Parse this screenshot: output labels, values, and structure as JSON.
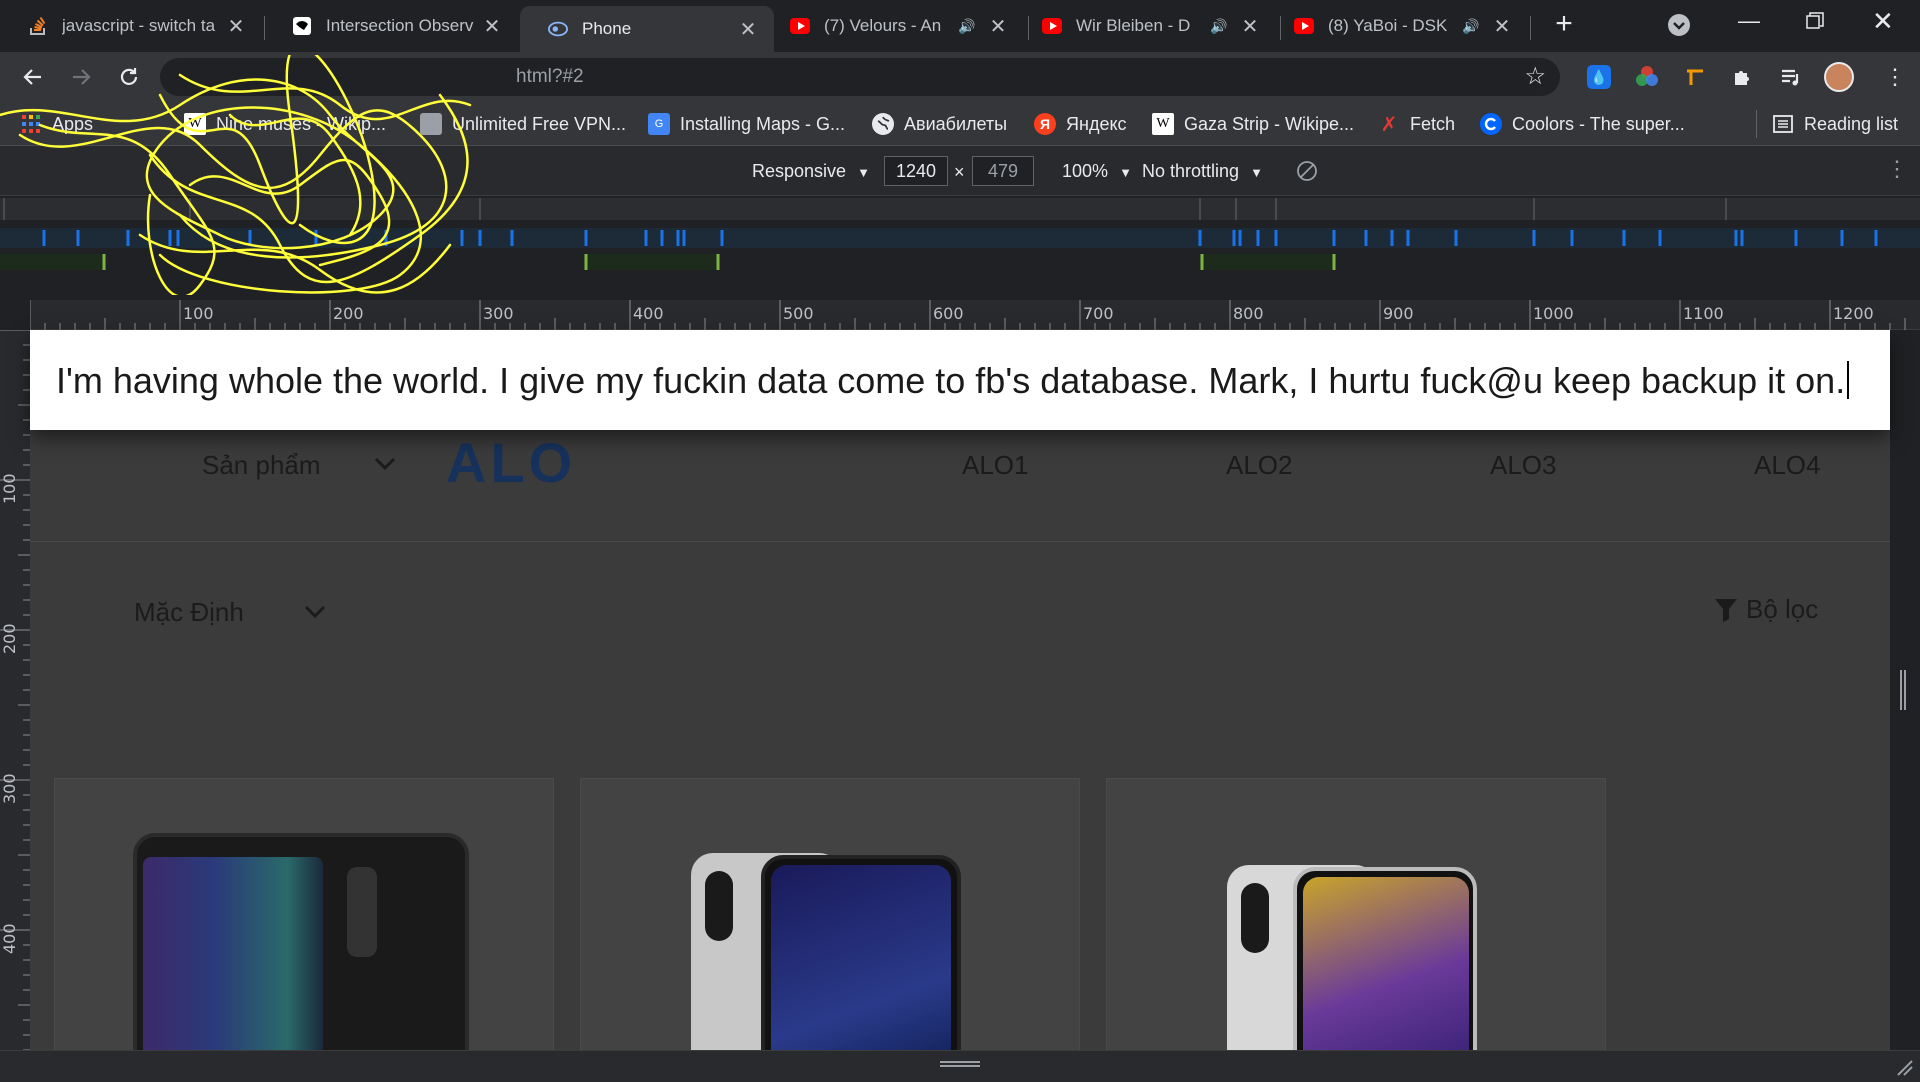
{
  "tabs": [
    {
      "title": "javascript - switch ta",
      "icon": "stackoverflow-icon",
      "active": false
    },
    {
      "title": "Intersection Observ",
      "icon": "page-icon",
      "active": false
    },
    {
      "title": "Phone",
      "icon": "globe-icon",
      "active": true
    },
    {
      "title": "(7) Velours - An",
      "icon": "youtube-icon",
      "active": false,
      "audio": true
    },
    {
      "title": "Wir Bleiben - D",
      "icon": "youtube-icon",
      "active": false,
      "audio": true
    },
    {
      "title": "(8) YaBoi - DSK",
      "icon": "youtube-icon",
      "active": false,
      "audio": true
    }
  ],
  "omnibox": {
    "url": "html?#2"
  },
  "bookmarks": [
    {
      "label": "Apps",
      "icon": "apps-grid-icon"
    },
    {
      "label": "Nine muses - Wikip...",
      "icon": "wikipedia-icon"
    },
    {
      "label": "Unlimited Free VPN...",
      "icon": "vpn-icon"
    },
    {
      "label": "Installing Maps - G...",
      "icon": "google-maps-icon"
    },
    {
      "label": "Авиабилеты",
      "icon": "globe-icon"
    },
    {
      "label": "Яндекс",
      "icon": "yandex-icon"
    },
    {
      "label": "Gaza Strip - Wikipe...",
      "icon": "wikipedia-icon"
    },
    {
      "label": "Fetch",
      "icon": "fetch-icon"
    },
    {
      "label": "Coolors - The super...",
      "icon": "coolors-icon"
    }
  ],
  "reading_list": "Reading list",
  "device_toolbar": {
    "mode": "Responsive",
    "width": "1240",
    "times": "×",
    "height": "479",
    "zoom": "100%",
    "throttling": "No throttling"
  },
  "ruler": {
    "h_labels": [
      "100",
      "200",
      "300",
      "400",
      "500",
      "600",
      "700",
      "800",
      "900",
      "1000",
      "1100",
      "1200"
    ],
    "v_labels": [
      "100",
      "200",
      "300",
      "400"
    ]
  },
  "banner": {
    "text": "I'm having whole the world. I give my fuckin data come to fb's database. Mark, I hurtu fuck@u keep backup it on."
  },
  "page": {
    "category_select": "Sản phẩm",
    "logo": "ALO",
    "nav_links": [
      "ALO1",
      "ALO2",
      "ALO3",
      "ALO4"
    ],
    "sort_select": "Mặc Định",
    "filter_label": "Bộ lọc"
  },
  "colors": {
    "browser_bg": "#202124",
    "toolbar_bg": "#35363a",
    "viewport_bg": "#3b3b3b",
    "logo_color": "#16325c",
    "scribble": "#ffff3a"
  }
}
